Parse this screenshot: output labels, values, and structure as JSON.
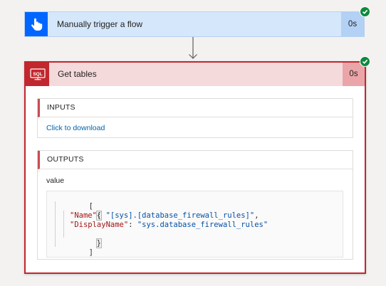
{
  "trigger": {
    "title": "Manually trigger a flow",
    "duration": "0s",
    "icon": "touch-hand-icon",
    "status": "succeeded"
  },
  "action": {
    "title": "Get tables",
    "duration": "0s",
    "icon": "sql-icon",
    "icon_text": "SQL",
    "status": "succeeded",
    "inputs": {
      "header": "INPUTS",
      "link": "Click to download"
    },
    "outputs": {
      "header": "OUTPUTS",
      "value_label": "value",
      "code": {
        "open_bracket": "[",
        "open_brace": "{",
        "name_key": "\"Name\"",
        "name_value": "\"[sys].[database_firewall_rules]\"",
        "display_key": "\"DisplayName\"",
        "display_value": "\"sys.database_firewall_rules\"",
        "colon": ": ",
        "comma": ",",
        "close_brace": "}",
        "close_bracket": "]"
      }
    }
  },
  "colors": {
    "trigger_bg": "#d5e7fb",
    "trigger_icon_bg": "#0066ff",
    "action_border": "#c1272d",
    "action_header_bg": "#f5dadb",
    "success": "#0d8a3c",
    "link": "#0062ad"
  }
}
